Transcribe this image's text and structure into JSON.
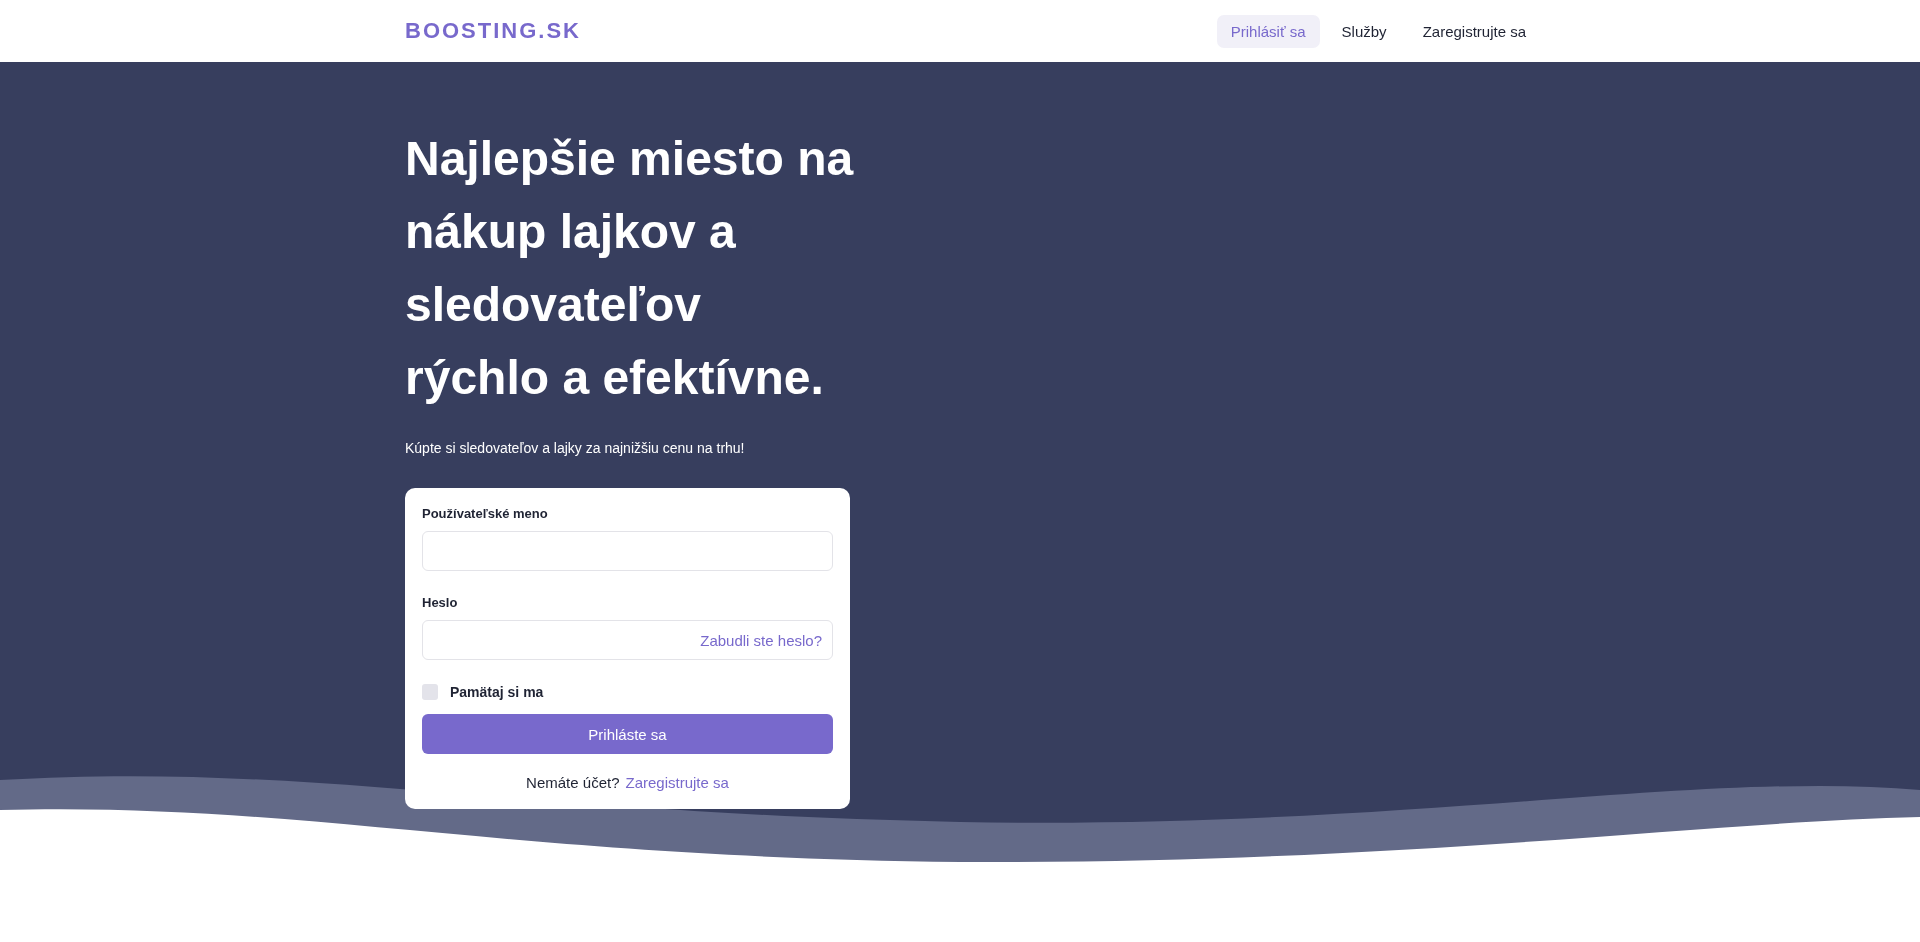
{
  "header": {
    "logo": "BOOSTING.SK",
    "nav": [
      {
        "label": "Prihlásiť sa",
        "selected": true
      },
      {
        "label": "Služby",
        "selected": false
      },
      {
        "label": "Zaregistrujte sa",
        "selected": false
      }
    ]
  },
  "hero": {
    "title": "Najlepšie miesto na nákup lajkov a sledovateľov rýchlo a efektívne.",
    "subtitle": "Kúpte si sledovateľov a lajky za najnižšiu cenu na trhu!"
  },
  "login_form": {
    "username_label": "Používateľské meno",
    "password_label": "Heslo",
    "forgot_link": "Zabudli ste heslo?",
    "remember": {
      "label": "Pamätaj si ma",
      "checked": false
    },
    "submit": "Prihláste sa",
    "signup_prompt": "Nemáte účet?",
    "signup_link": "Zaregistrujte sa"
  }
}
